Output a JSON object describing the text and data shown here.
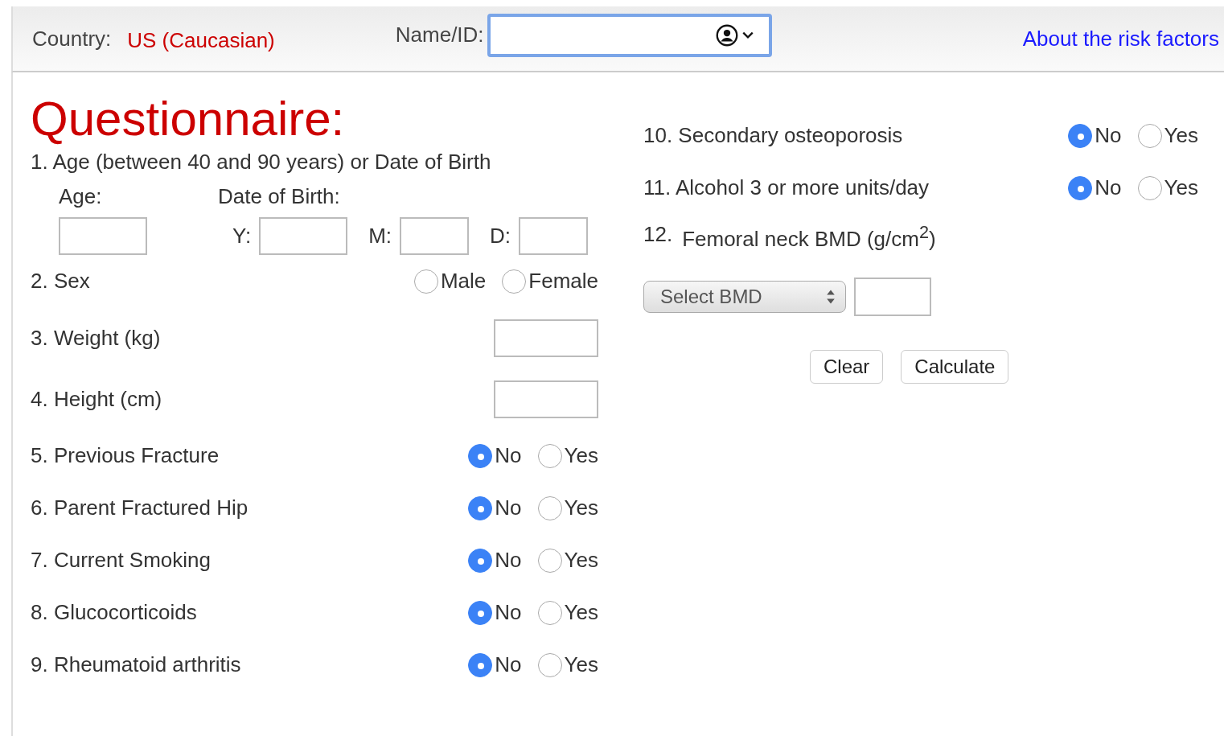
{
  "header": {
    "country_label": "Country:",
    "country": "US (Caucasian)",
    "name_label": "Name/ID:",
    "about_link": "About the risk factors"
  },
  "title": "Questionnaire:",
  "left_questions": [
    {
      "kind": "age",
      "label": "1. Age (between 40 and 90 years) or Date of Birth",
      "age_label": "Age:",
      "dob_label": "Date of Birth:",
      "date_fields": [
        {
          "label": "Y:"
        },
        {
          "label": "M:"
        },
        {
          "label": "D:"
        }
      ]
    },
    {
      "kind": "radio",
      "label": "2. Sex",
      "options": [
        {
          "label": "Male",
          "selected": false
        },
        {
          "label": "Female",
          "selected": false
        }
      ]
    },
    {
      "kind": "input",
      "label": "3. Weight (kg)"
    },
    {
      "kind": "input",
      "label": "4. Height (cm)"
    },
    {
      "kind": "radio",
      "label": "5. Previous Fracture",
      "options": [
        {
          "label": "No",
          "selected": true
        },
        {
          "label": "Yes",
          "selected": false
        }
      ]
    },
    {
      "kind": "radio",
      "label": "6. Parent Fractured Hip",
      "options": [
        {
          "label": "No",
          "selected": true
        },
        {
          "label": "Yes",
          "selected": false
        }
      ]
    },
    {
      "kind": "radio",
      "label": "7. Current Smoking",
      "options": [
        {
          "label": "No",
          "selected": true
        },
        {
          "label": "Yes",
          "selected": false
        }
      ]
    },
    {
      "kind": "radio",
      "label": "8. Glucocorticoids",
      "options": [
        {
          "label": "No",
          "selected": true
        },
        {
          "label": "Yes",
          "selected": false
        }
      ]
    },
    {
      "kind": "radio",
      "label": "9. Rheumatoid arthritis",
      "options": [
        {
          "label": "No",
          "selected": true
        },
        {
          "label": "Yes",
          "selected": false
        }
      ]
    }
  ],
  "right_questions": [
    {
      "kind": "radio",
      "label": "10. Secondary osteoporosis",
      "options": [
        {
          "label": "No",
          "selected": true
        },
        {
          "label": "Yes",
          "selected": false
        }
      ]
    },
    {
      "kind": "radio",
      "label": "11. Alcohol 3 or more units/day",
      "options": [
        {
          "label": "No",
          "selected": true
        },
        {
          "label": "Yes",
          "selected": false
        }
      ]
    },
    {
      "kind": "bmd",
      "number": "12.",
      "label": "Femoral neck BMD (g/cm$^{2}$)",
      "select": "Select BMD"
    }
  ],
  "buttons": [
    "Clear",
    "Calculate"
  ]
}
